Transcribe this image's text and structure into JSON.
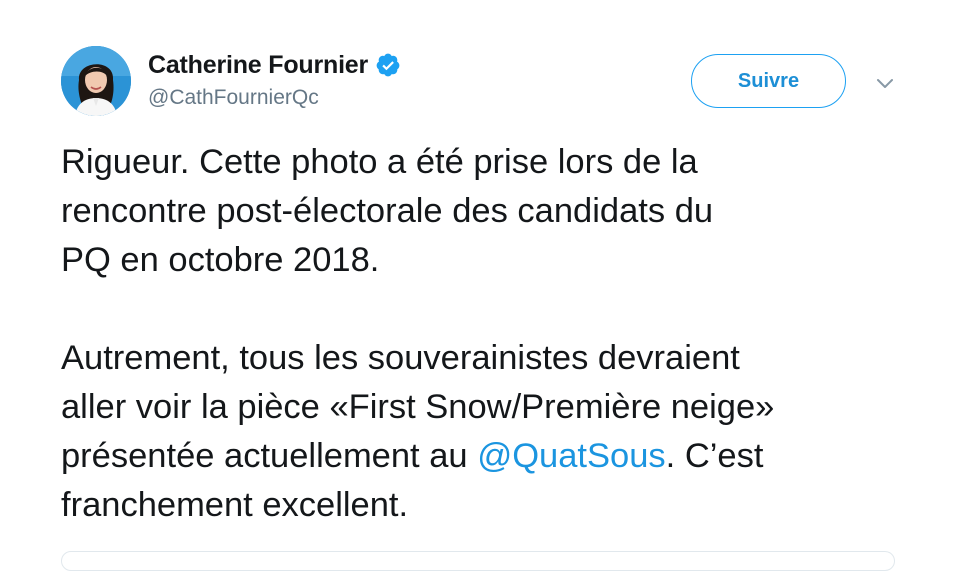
{
  "user": {
    "display_name": "Catherine Fournier",
    "handle": "@CathFournierQc",
    "verified": true,
    "avatar_icon": "profile-photo"
  },
  "actions": {
    "follow_label": "Suivre",
    "more_icon": "chevron-down-icon"
  },
  "tweet": {
    "lines": [
      "Rigueur. Cette photo a été prise lors de la",
      "rencontre post-électorale des candidats du",
      "PQ en octobre 2018.",
      "",
      "Autrement, tous les souverainistes devraient",
      "aller voir la pièce «First Snow/Première neige»",
      "présentée actuellement au ",
      "franchement excellent."
    ],
    "mention": "@QuatSous",
    "mention_suffix": ". C’est"
  },
  "colors": {
    "accent": "#1da1f2",
    "link": "#1b95e0",
    "text": "#14171a",
    "secondary": "#657786"
  }
}
